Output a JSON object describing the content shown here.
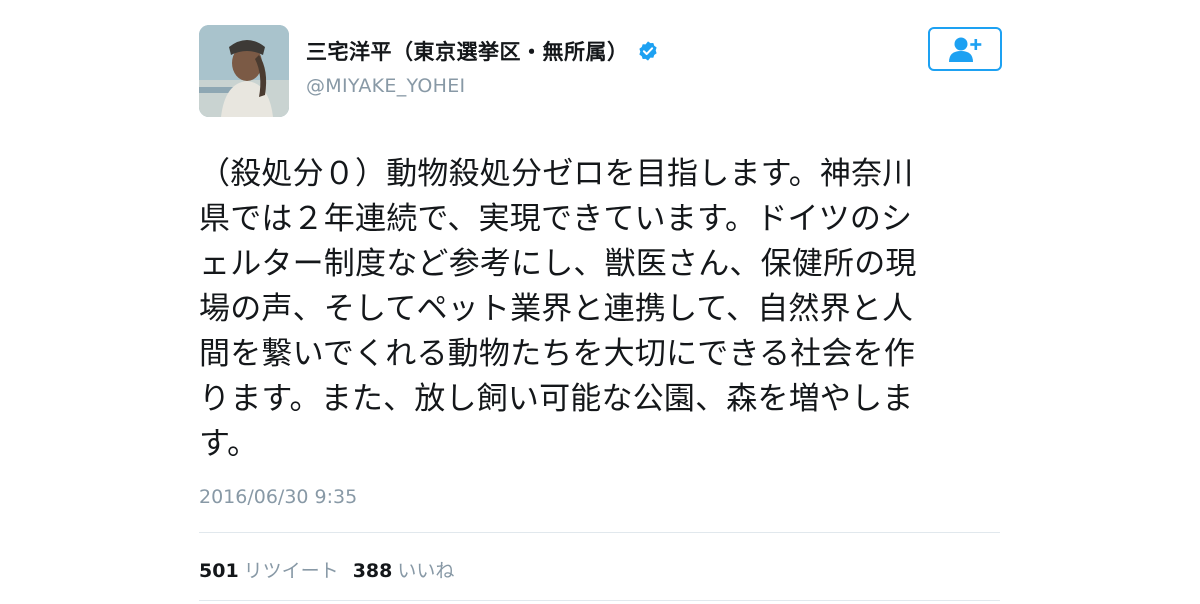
{
  "user": {
    "display_name": "三宅洋平（東京選挙区・無所属）",
    "handle": "@MIYAKE_YOHEI",
    "verified": true,
    "avatar_icon": "profile-photo"
  },
  "follow_button": {
    "icon": "add-user-icon"
  },
  "tweet": {
    "text": "（殺処分０）動物殺処分ゼロを目指します。神奈川\n県では２年連続で、実現できています。ドイツのシ\nェルター制度など参考にし、獣医さん、保健所の現\n場の声、そしてペット業界と連携して、自然界と人\n間を繋いでくれる動物たちを大切にできる社会を作\nります。また、放し飼い可能な公園、森を増やしま\nす。",
    "timestamp": "2016/06/30 9:35"
  },
  "stats": {
    "retweets": "501",
    "retweets_label": "リツイート",
    "likes": "388",
    "likes_label": "いいね"
  },
  "colors": {
    "accent": "#1da1f2",
    "text": "#14171a",
    "muted": "#8899a6",
    "divider": "#e1e8ed"
  }
}
